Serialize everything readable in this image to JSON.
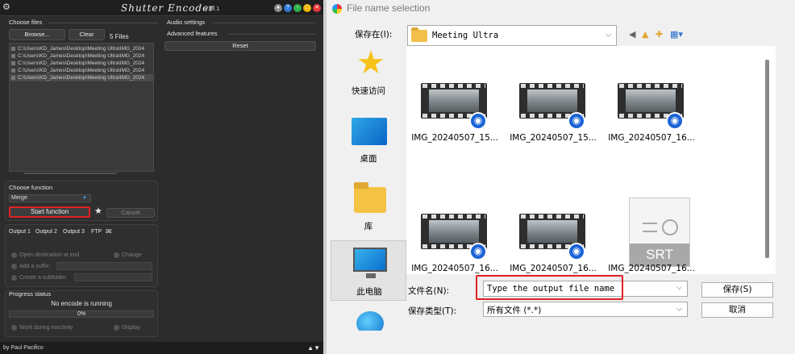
{
  "shutter": {
    "app_name": "Shutter Encoder",
    "version": "v18.1",
    "choose_files": "Choose files",
    "browse": "Browse...",
    "clear": "Clear",
    "file_count": "5 Files",
    "files": [
      "C:\\Users\\KD_James\\Desktop\\Meeting Ultra\\IMG_2024",
      "C:\\Users\\KD_James\\Desktop\\Meeting Ultra\\IMG_2024",
      "C:\\Users\\KD_James\\Desktop\\Meeting Ultra\\IMG_2024",
      "C:\\Users\\KD_James\\Desktop\\Meeting Ultra\\IMG_2024",
      "C:\\Users\\KD_James\\Desktop\\Meeting Ultra\\IMG_2024"
    ],
    "audio_settings": "Audio settings",
    "advanced_features": "Advanced features",
    "reset": "Reset",
    "choose_function": "Choose function",
    "function_value": "Merge",
    "start_function": "Start function",
    "cancel": "Cancel",
    "outputs": [
      "Output 1",
      "Output 2",
      "Output 3",
      "FTP"
    ],
    "open_destination": "Open destination at end",
    "change": "Change",
    "add_suffix": "Add a suffix:",
    "create_subfolder": "Create a subfolder:",
    "progress_status": "Progress status",
    "no_encode": "No encode is running",
    "progress_text": "0%",
    "progress": 0,
    "work_inactivity": "Work during inactivity",
    "display": "Display",
    "footer": "by Paul Pacifico",
    "footer_arrows": "▲▼",
    "dot_colors": [
      "#8c8c8c",
      "#2f7bd9",
      "#2fb34a",
      "#f0b400",
      "#e23636"
    ],
    "dot_glyphs": [
      "●",
      "?",
      "−",
      "□",
      "✕"
    ]
  },
  "dialog": {
    "title": "File name selection",
    "save_in_label": "保存在(I):",
    "save_in_value": "Meeting Ultra",
    "places": [
      {
        "label": "快速访问",
        "icon": "star"
      },
      {
        "label": "桌面",
        "icon": "desktop"
      },
      {
        "label": "库",
        "icon": "library"
      },
      {
        "label": "此电脑",
        "icon": "computer"
      }
    ],
    "files": [
      {
        "name": "IMG_20240507_15...",
        "type": "video"
      },
      {
        "name": "IMG_20240507_15...",
        "type": "video"
      },
      {
        "name": "IMG_20240507_16...",
        "type": "video"
      },
      {
        "name": "IMG_20240507_16...",
        "type": "video"
      },
      {
        "name": "IMG_20240507_16...",
        "type": "video"
      },
      {
        "name": "IMG_20240507_16...",
        "type": "srt"
      }
    ],
    "srt_label": "SRT",
    "filename_label": "文件名(N):",
    "filename_value": "Type the output file name",
    "filetype_label": "保存类型(T):",
    "filetype_value": "所有文件 (*.*)",
    "save_button": "保存(S)",
    "cancel_button": "取消",
    "accent": "#e02222"
  }
}
